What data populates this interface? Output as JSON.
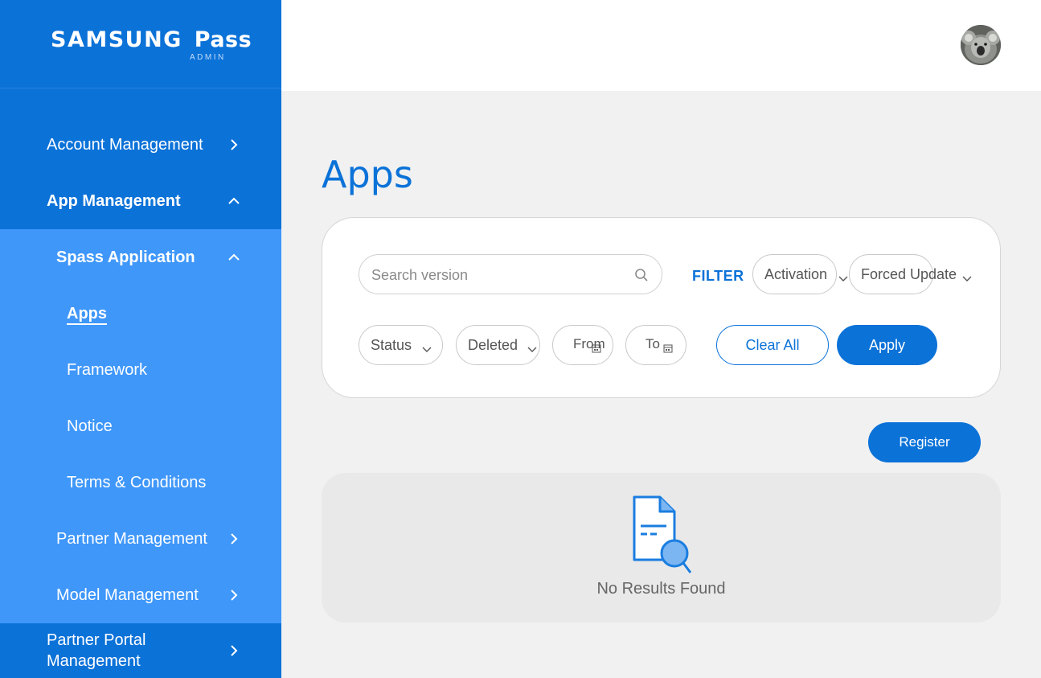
{
  "brand": {
    "name": "SAMSUNG",
    "name2": "Pass",
    "sub": "ADMIN"
  },
  "sidebar": {
    "items": [
      {
        "label": "Account Management",
        "chevron": "chevron-right-icon"
      },
      {
        "label": "App Management",
        "chevron": "chevron-up-icon"
      },
      {
        "label": "Spass Application",
        "chevron": "chevron-up-icon"
      },
      {
        "label": "Apps"
      },
      {
        "label": "Framework"
      },
      {
        "label": "Notice"
      },
      {
        "label": "Terms & Conditions"
      },
      {
        "label": "Partner Management",
        "chevron": "chevron-right-icon"
      },
      {
        "label": "Model Management",
        "chevron": "chevron-right-icon"
      },
      {
        "label_line1": "Partner Portal",
        "label_line2": "Management",
        "chevron": "chevron-right-icon"
      }
    ]
  },
  "main": {
    "title": "Apps",
    "search": {
      "placeholder": "Search version"
    },
    "filter_label": "FILTER",
    "filters": {
      "activation": "Activation",
      "forced_update": "Forced Update",
      "status": "Status",
      "deleted": "Deleted",
      "from": "From",
      "to": "To"
    },
    "clear_all": "Clear All",
    "apply": "Apply",
    "register": "Register",
    "empty_message": "No Results Found"
  },
  "colors": {
    "primary": "#0b72d8",
    "submenu": "#3f97fa",
    "background": "#f1f1f1"
  }
}
